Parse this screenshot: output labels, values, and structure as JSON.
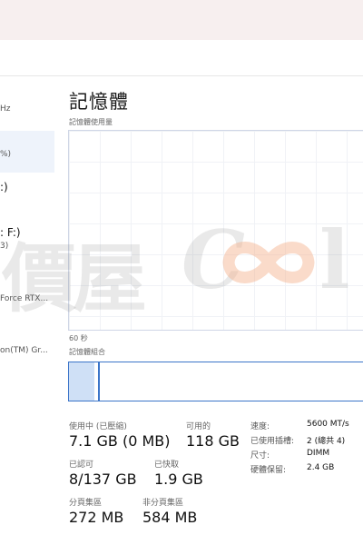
{
  "sidebar": {
    "items": [
      {
        "lines": [
          "Hz"
        ]
      },
      {
        "lines": [
          "%)"
        ]
      },
      {
        "lines": [
          ":)"
        ]
      },
      {
        "lines": [
          ": F:)",
          "3)"
        ]
      },
      {
        "lines": [
          "Force RTX..."
        ]
      },
      {
        "lines": [
          "on(TM) Gr..."
        ]
      }
    ]
  },
  "main": {
    "title": "記憶體",
    "graph_label": "記憶體使用量",
    "time_label": "60 秒",
    "composition_label": "記憶體組合"
  },
  "composition": {
    "used_fraction": 0.085,
    "modified_fraction": 0.012
  },
  "stats": {
    "in_use_label": "使用中 (已壓縮)",
    "in_use_value": "7.1 GB (0 MB)",
    "available_label": "可用的",
    "available_value": "118 GB",
    "committed_label": "已認可",
    "committed_value": "8/137 GB",
    "cached_label": "已快取",
    "cached_value": "1.9 GB",
    "paged_label": "分頁集區",
    "paged_value": "272 MB",
    "nonpaged_label": "非分頁集區",
    "nonpaged_value": "584 MB"
  },
  "specs": [
    {
      "label": "速度:",
      "value": "5600 MT/s"
    },
    {
      "label": "已使用插槽:",
      "value": "2 (總共 4)"
    },
    {
      "label": "尺寸:",
      "value": "DIMM"
    },
    {
      "label": "硬體保留:",
      "value": "2.4 GB"
    }
  ],
  "watermark": {
    "text": "價屋",
    "latin_c": "C",
    "latin_l": "l",
    "loop_color": "#f4b089"
  }
}
